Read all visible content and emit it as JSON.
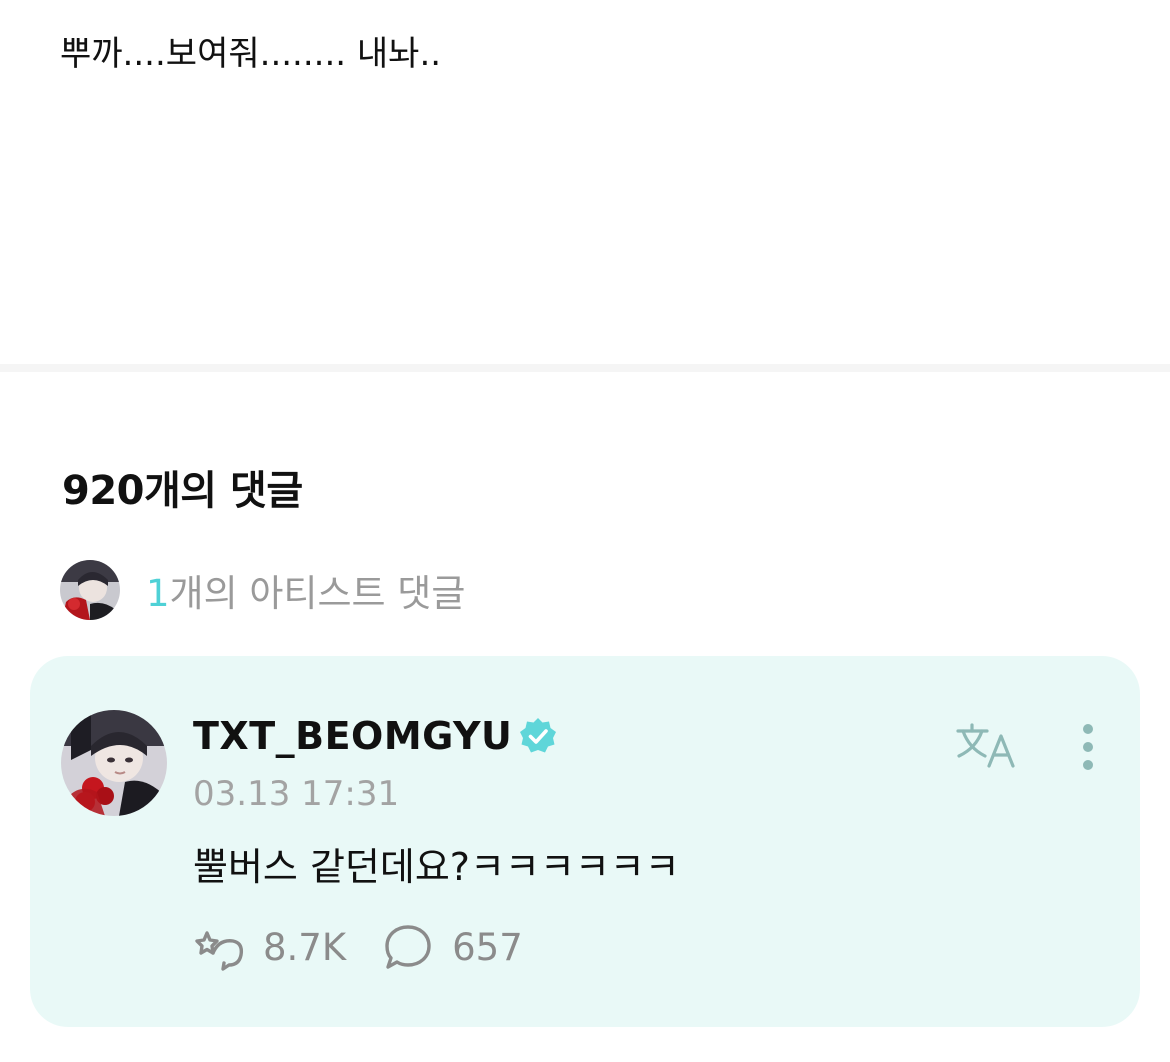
{
  "post": {
    "body_text": "뿌까....보여줘........ 내놔.."
  },
  "comments": {
    "title": "920개의 댓글",
    "artist_comments": {
      "count": "1",
      "label": "개의 아티스트 댓글"
    }
  },
  "comment": {
    "author": "TXT_BEOMGYU",
    "verified": true,
    "timestamp": "03.13 17:31",
    "text": "뿔버스 같던데요?ㅋㅋㅋㅋㅋㅋ",
    "likes": "8.7K",
    "replies": "657",
    "icons": {
      "verified": "verified-badge-icon",
      "translate": "translate-icon",
      "more": "more-vertical-icon",
      "like": "like-icon",
      "reply": "reply-bubble-icon"
    }
  },
  "colors": {
    "accent": "#4fd1d6",
    "card_background": "#e9f9f7",
    "muted_text": "#a3a3a3"
  }
}
